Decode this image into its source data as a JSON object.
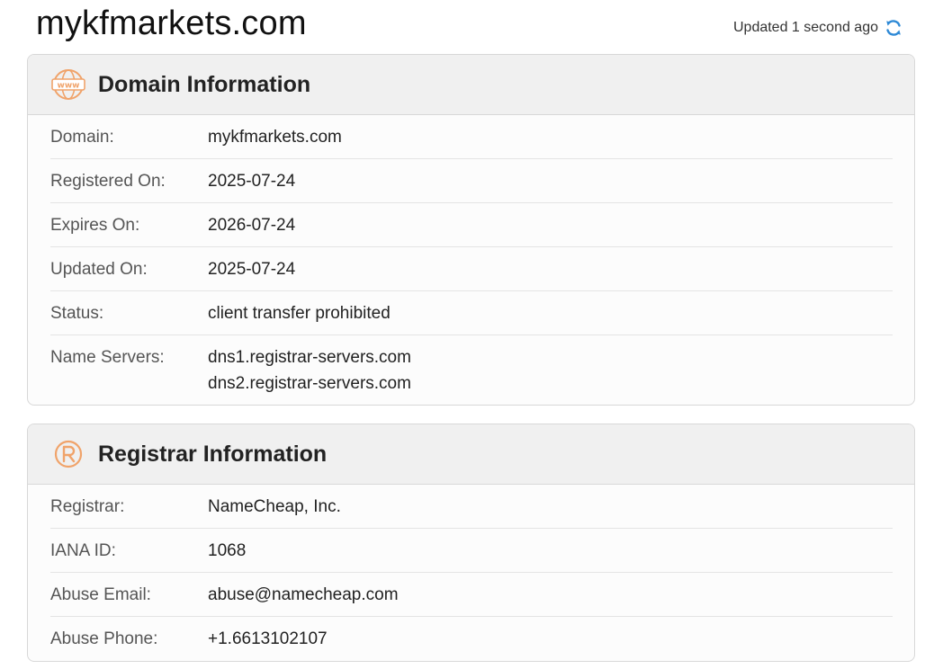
{
  "header": {
    "site_title": "mykfmarkets.com",
    "updated_text": "Updated 1 second ago"
  },
  "icons": {
    "refresh": "refresh-icon",
    "www": "www-globe-icon",
    "registered": "registered-trademark-icon"
  },
  "colors": {
    "accent_orange": "#f0a36a",
    "refresh_blue": "#2f8ad6"
  },
  "domain_info": {
    "title": "Domain Information",
    "rows": [
      {
        "label": "Domain:",
        "value": "mykfmarkets.com"
      },
      {
        "label": "Registered On:",
        "value": "2025-07-24"
      },
      {
        "label": "Expires On:",
        "value": "2026-07-24"
      },
      {
        "label": "Updated On:",
        "value": "2025-07-24"
      },
      {
        "label": "Status:",
        "value": "client transfer prohibited"
      },
      {
        "label": "Name Servers:",
        "values": [
          "dns1.registrar-servers.com",
          "dns2.registrar-servers.com"
        ]
      }
    ]
  },
  "registrar_info": {
    "title": "Registrar Information",
    "rows": [
      {
        "label": "Registrar:",
        "value": "NameCheap, Inc."
      },
      {
        "label": "IANA ID:",
        "value": "1068"
      },
      {
        "label": "Abuse Email:",
        "value": "abuse@namecheap.com"
      },
      {
        "label": "Abuse Phone:",
        "value": "+1.6613102107"
      }
    ]
  }
}
